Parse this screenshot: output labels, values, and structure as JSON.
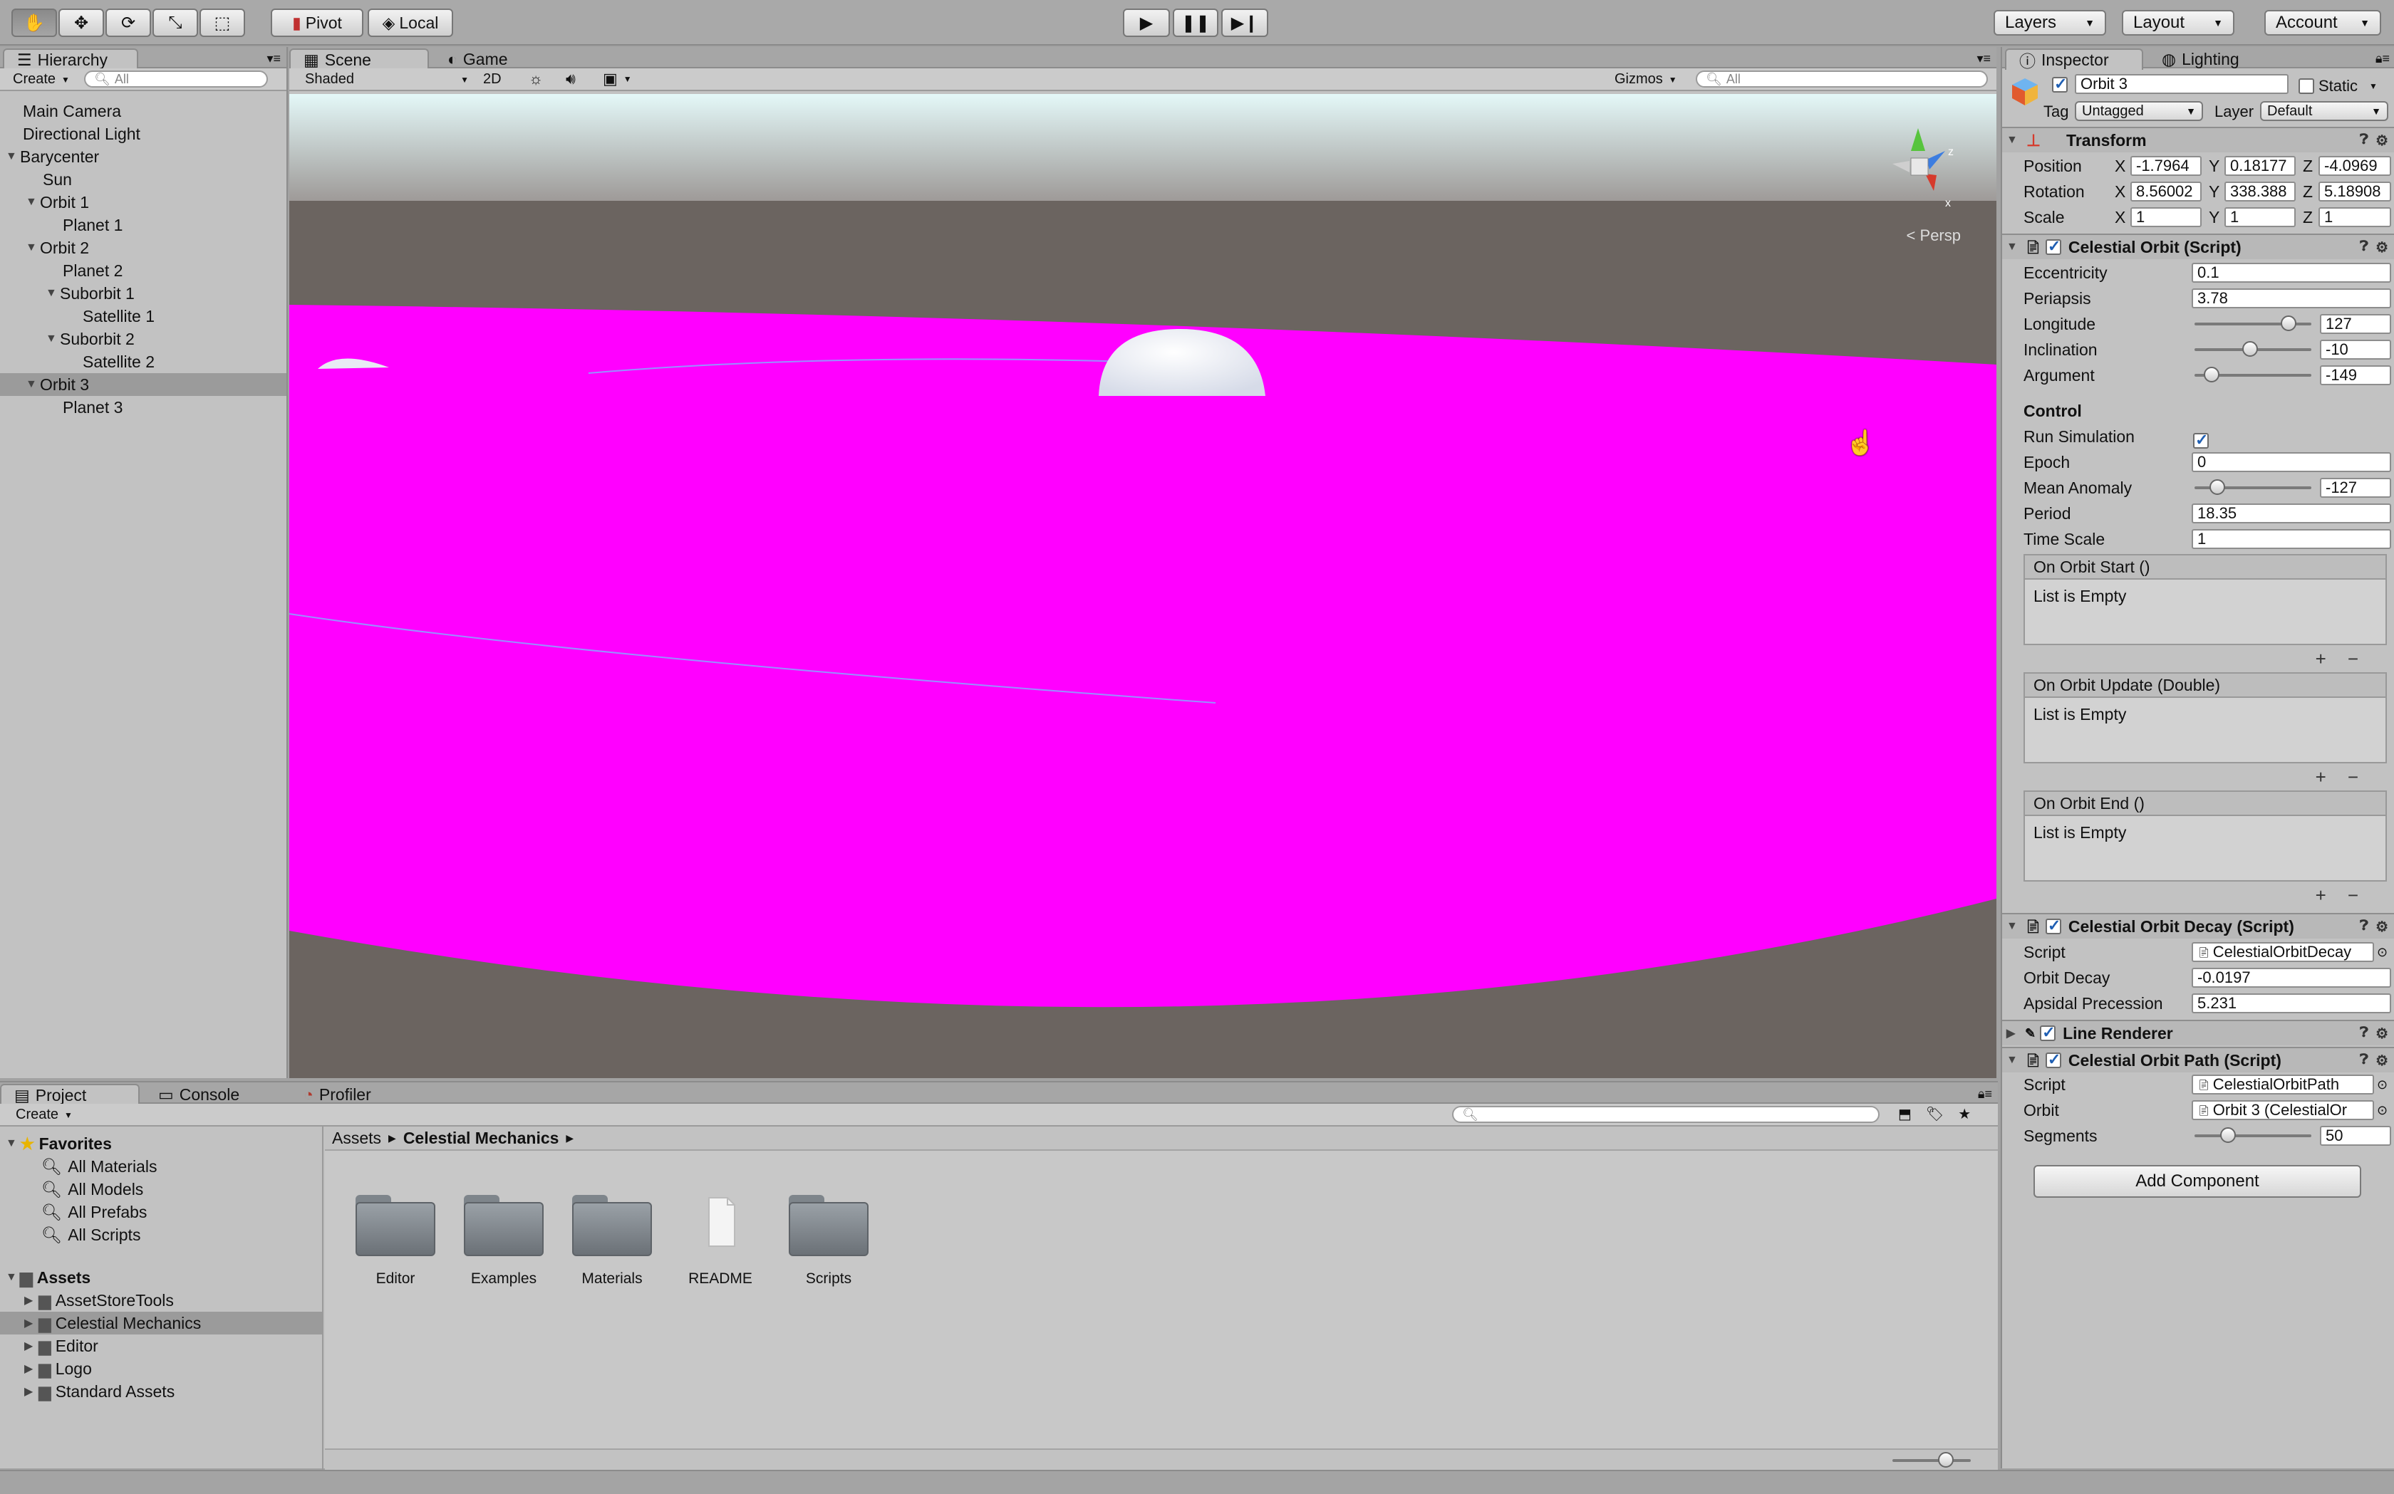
{
  "toolbar": {
    "tools": [
      "hand-tool",
      "move-tool",
      "rotate-tool",
      "scale-tool",
      "rect-tool"
    ],
    "pivot_label": "Pivot",
    "local_label": "Local",
    "layers_label": "Layers",
    "layout_label": "Layout",
    "account_label": "Account"
  },
  "hierarchy": {
    "tab": "Hierarchy",
    "create_label": "Create",
    "search_placeholder": "All",
    "items": [
      {
        "label": "Main Camera"
      },
      {
        "label": "Directional Light"
      },
      {
        "label": "Barycenter"
      },
      {
        "label": "Sun"
      },
      {
        "label": "Orbit 1"
      },
      {
        "label": "Planet 1"
      },
      {
        "label": "Orbit 2"
      },
      {
        "label": "Planet 2"
      },
      {
        "label": "Suborbit 1"
      },
      {
        "label": "Satellite 1"
      },
      {
        "label": "Suborbit 2"
      },
      {
        "label": "Satellite 2"
      },
      {
        "label": "Orbit 3"
      },
      {
        "label": "Planet 3"
      }
    ]
  },
  "scene": {
    "tabs": [
      {
        "label": "Scene"
      },
      {
        "label": "Game"
      }
    ],
    "shading_mode": "Shaded",
    "mode_2d": "2D",
    "gizmos_label": "Gizmos",
    "search_placeholder": "All",
    "persp_label": "Persp",
    "colors": {
      "magenta": "#ff00ff",
      "ground": "#6b6460",
      "sky_top": "#dff6f7"
    }
  },
  "inspector": {
    "tabs": [
      {
        "label": "Inspector"
      },
      {
        "label": "Lighting"
      }
    ],
    "object_name": "Orbit 3",
    "static_label": "Static",
    "tag_label": "Tag",
    "tag_value": "Untagged",
    "layer_label": "Layer",
    "layer_value": "Default",
    "transform": {
      "title": "Transform",
      "position_label": "Position",
      "rotation_label": "Rotation",
      "scale_label": "Scale",
      "axis_x": "X",
      "axis_y": "Y",
      "axis_z": "Z",
      "position": {
        "x": "-1.7964",
        "y": "0.18177",
        "z": "-4.0969"
      },
      "rotation": {
        "x": "8.56002",
        "y": "338.388",
        "z": "5.18908"
      },
      "scale": {
        "x": "1",
        "y": "1",
        "z": "1"
      }
    },
    "celestial_orbit": {
      "title": "Celestial Orbit (Script)",
      "eccentricity_label": "Eccentricity",
      "eccentricity": "0.1",
      "periapsis_label": "Periapsis",
      "periapsis": "3.78",
      "longitude_label": "Longitude",
      "longitude": "127",
      "longitude_fraction": 0.85,
      "inclination_label": "Inclination",
      "inclination": "-10",
      "inclination_fraction": 0.47,
      "argument_label": "Argument",
      "argument": "-149",
      "argument_fraction": 0.09,
      "control_label": "Control",
      "run_simulation_label": "Run Simulation",
      "run_simulation": true,
      "epoch_label": "Epoch",
      "epoch": "0",
      "mean_anomaly_label": "Mean Anomaly",
      "mean_anomaly": "-127",
      "mean_anomaly_fraction": 0.15,
      "period_label": "Period",
      "period": "18.35",
      "time_scale_label": "Time Scale",
      "time_scale": "1",
      "events": [
        {
          "title": "On Orbit Start ()",
          "body": "List is Empty"
        },
        {
          "title": "On Orbit Update (Double)",
          "body": "List is Empty"
        },
        {
          "title": "On Orbit End ()",
          "body": "List is Empty"
        }
      ]
    },
    "orbit_decay": {
      "title": "Celestial Orbit Decay (Script)",
      "script_label": "Script",
      "script_value": "CelestialOrbitDecay",
      "orbit_decay_label": "Orbit Decay",
      "orbit_decay": "-0.0197",
      "apsidal_label": "Apsidal Precession",
      "apsidal": "5.231"
    },
    "line_renderer": {
      "title": "Line Renderer"
    },
    "orbit_path": {
      "title": "Celestial Orbit Path (Script)",
      "script_label": "Script",
      "script_value": "CelestialOrbitPath",
      "orbit_label": "Orbit",
      "orbit_value": "Orbit 3 (CelestialOr",
      "segments_label": "Segments",
      "segments": "50",
      "segments_fraction": 0.25
    },
    "add_component_label": "Add Component"
  },
  "project": {
    "tabs": [
      {
        "label": "Project"
      },
      {
        "label": "Console"
      },
      {
        "label": "Profiler"
      }
    ],
    "create_label": "Create",
    "favorites_label": "Favorites",
    "favorites": [
      {
        "label": "All Materials"
      },
      {
        "label": "All Models"
      },
      {
        "label": "All Prefabs"
      },
      {
        "label": "All Scripts"
      }
    ],
    "assets_label": "Assets",
    "assets_tree": [
      {
        "label": "AssetStoreTools"
      },
      {
        "label": "Celestial Mechanics"
      },
      {
        "label": "Editor"
      },
      {
        "label": "Logo"
      },
      {
        "label": "Standard Assets"
      }
    ],
    "breadcrumb": [
      "Assets",
      "Celestial Mechanics"
    ],
    "items": [
      {
        "label": "Editor"
      },
      {
        "label": "Examples"
      },
      {
        "label": "Materials"
      },
      {
        "label": "README"
      },
      {
        "label": "Scripts"
      }
    ]
  }
}
